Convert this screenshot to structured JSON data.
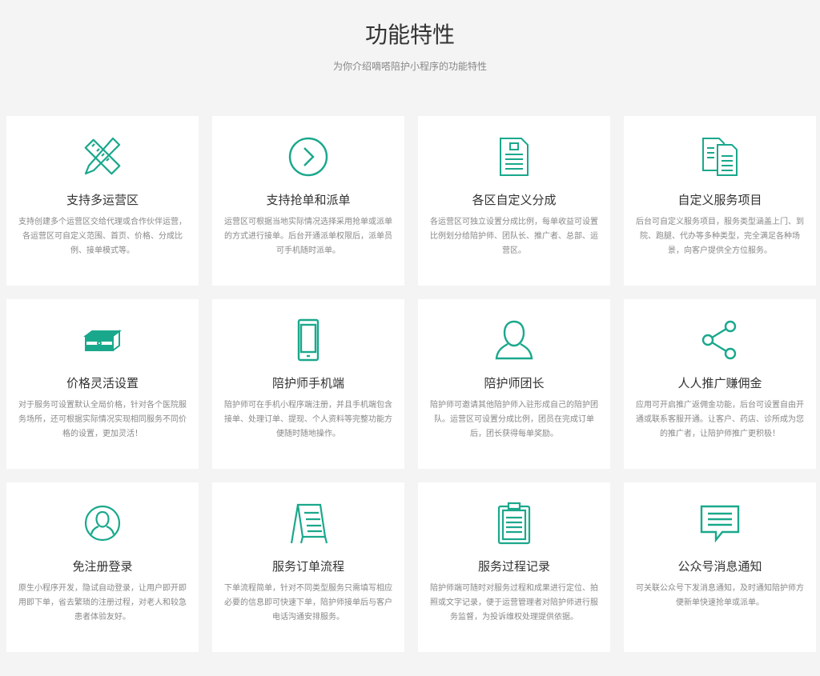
{
  "header": {
    "title": "功能特性",
    "subtitle": "为你介绍嘀嗒陪护小程序的功能特性"
  },
  "accent_color": "#1aa88c",
  "features": [
    {
      "icon": "ruler-pencil-icon",
      "title": "支持多运营区",
      "desc": "支持创建多个运营区交给代理或合作伙伴运营，各运营区可自定义范围、首页、价格、分成比例、接单模式等。"
    },
    {
      "icon": "arrow-circle-icon",
      "title": "支持抢单和派单",
      "desc": "运营区可根据当地实际情况选择采用抢单或派单的方式进行接单。后台开通派单权限后，派单员可手机随时派单。"
    },
    {
      "icon": "document-icon",
      "title": "各区自定义分成",
      "desc": "各运营区可独立设置分成比例，每单收益可设置比例划分给陪护师、团队长、推广者、总部、运营区。"
    },
    {
      "icon": "documents-icon",
      "title": "自定义服务项目",
      "desc": "后台可自定义服务项目，服务类型涵盖上门、到院、跑腿、代办等多种类型，完全满足各种场景，向客户提供全方位服务。"
    },
    {
      "icon": "money-stack-icon",
      "title": "价格灵活设置",
      "desc": "对于服务可设置默认全局价格，针对各个医院服务场所，还可根据实际情况实现相同服务不同价格的设置，更加灵活！"
    },
    {
      "icon": "mobile-phone-icon",
      "title": "陪护师手机端",
      "desc": "陪护师可在手机小程序端注册，并且手机端包含接单、处理订单、提现、个人资料等完整功能方便随时随地操作。"
    },
    {
      "icon": "user-icon",
      "title": "陪护师团长",
      "desc": "陪护师可邀请其他陪护师入驻形成自己的陪护团队。运营区可设置分成比例，团员在完成订单后，团长获得每单奖励。"
    },
    {
      "icon": "share-icon",
      "title": "人人推广赚佣金",
      "desc": "应用可开启推广返佣金功能，后台可设置自由开通或联系客服开通。让客户、药店、诊所成为您的推广者，让陪护师推广更积极！"
    },
    {
      "icon": "user-circle-icon",
      "title": "免注册登录",
      "desc": "原生小程序开发，隐试自动登录，让用户即开即用即下单，省去繁琐的注册过程，对老人和较急患者体验友好。"
    },
    {
      "icon": "easel-icon",
      "title": "服务订单流程",
      "desc": "下单流程简单，针对不同类型服务只需填写相应必要的信息即可快速下单，陪护师接单后与客户电话沟通安排服务。"
    },
    {
      "icon": "clipboard-icon",
      "title": "服务过程记录",
      "desc": "陪护师端可随时对服务过程和成果进行定位、拍照或文字记录，便于运营管理者对陪护师进行服务监督，为投诉维权处理提供依据。"
    },
    {
      "icon": "message-icon",
      "title": "公众号消息通知",
      "desc": "可关联公众号下发消息通知，及时通知陪护师方便新单快速抢单或派单。"
    }
  ]
}
